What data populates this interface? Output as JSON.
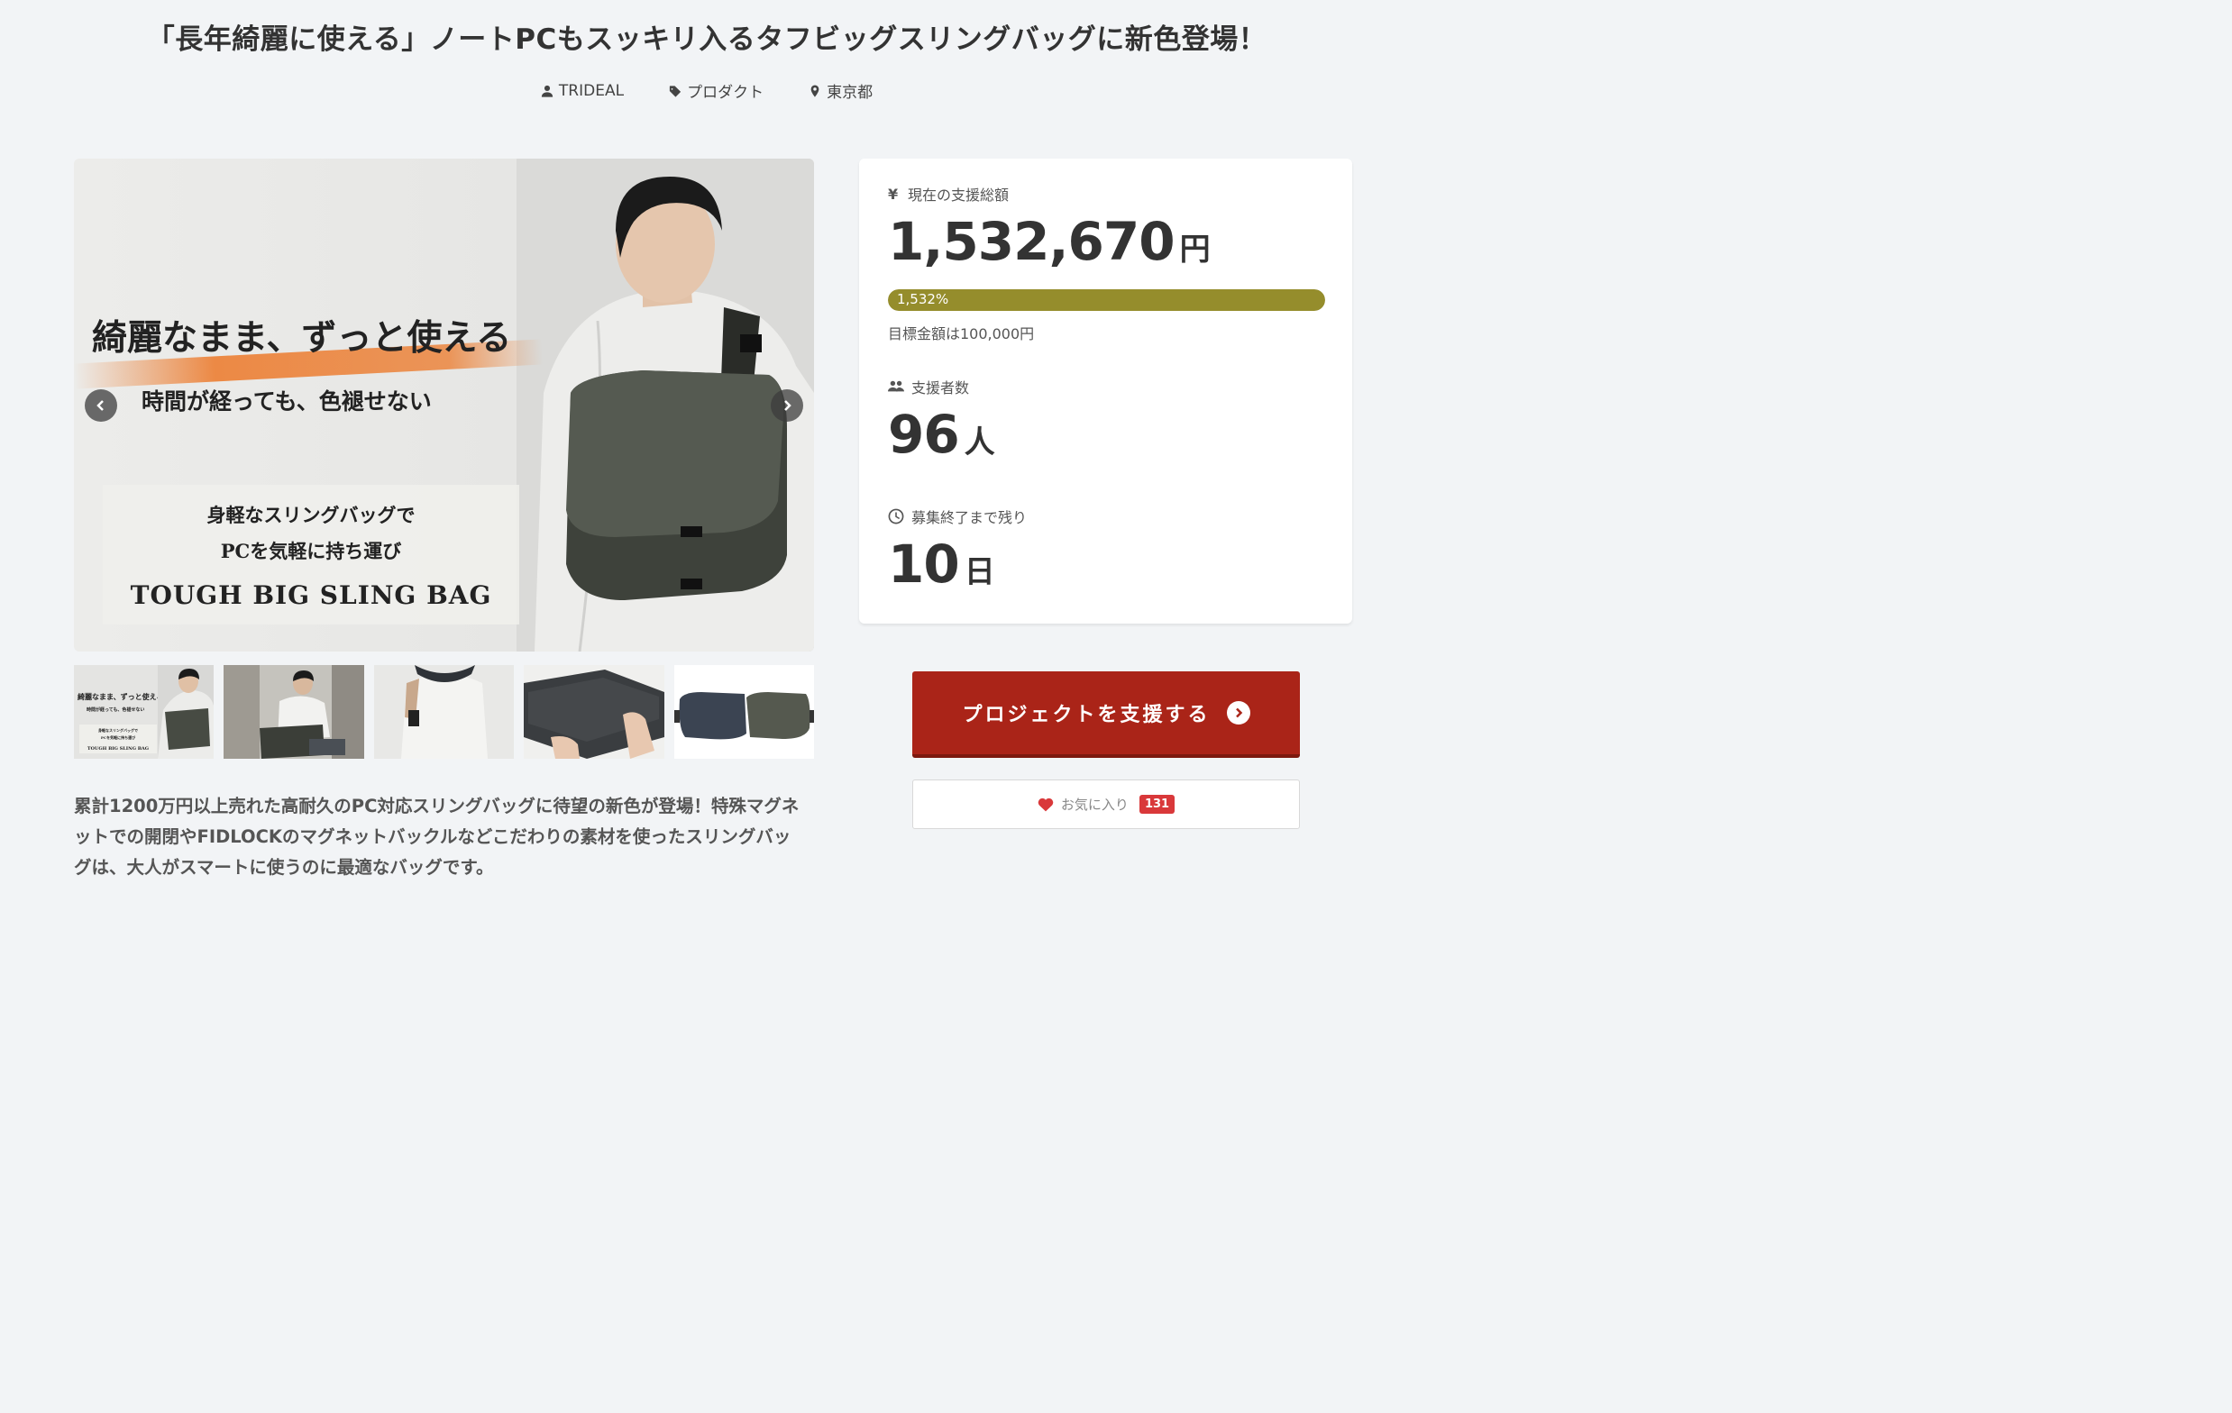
{
  "title": "「長年綺麗に使える」ノートPCもスッキリ入るタフビッグスリングバッグに新色登場！",
  "meta": {
    "owner": "TRIDEAL",
    "category": "プロダクト",
    "location": "東京都"
  },
  "main_image": {
    "headline": "綺麗なまま、ずっと使える",
    "subheadline": "時間が経っても、色褪せない",
    "box_line1": "身軽なスリングバッグで",
    "box_line2": "PCを気軽に持ち運び",
    "box_line3": "TOUGH BIG SLING BAG"
  },
  "thumbnails": [
    {
      "caption_1": "綺麗なまま、ずっと使える",
      "caption_2": "時間が経っても、色褪せない",
      "caption_3": "身軽なスリングバッグで",
      "caption_4": "PCを気軽に持ち運び",
      "caption_5": "TOUGH BIG SLING BAG"
    },
    {},
    {},
    {},
    {}
  ],
  "description": "累計1200万円以上売れた高耐久のPC対応スリングバッグに待望の新色が登場！特殊マグネットでの開閉やFIDLOCKのマグネットバックルなどこだわりの素材を使ったスリングバッグは、大人がスマートに使うのに最適なバッグです。",
  "stats": {
    "amount_label": "現在の支援総額",
    "amount": "1,532,670",
    "amount_unit": "円",
    "progress_text": "1,532%",
    "progress_fraction": 1.0,
    "goal_text": "目標金額は100,000円",
    "supporters_label": "支援者数",
    "supporters": "96",
    "supporters_unit": "人",
    "remaining_label": "募集終了まで残り",
    "remaining": "10",
    "remaining_unit": "日"
  },
  "support_button": "プロジェクトを支援する",
  "favorite": {
    "label": "お気に入り",
    "count": "131"
  },
  "colors": {
    "support_button": "#aa2418",
    "progress": "#958d2c",
    "badge": "#d9383a"
  }
}
